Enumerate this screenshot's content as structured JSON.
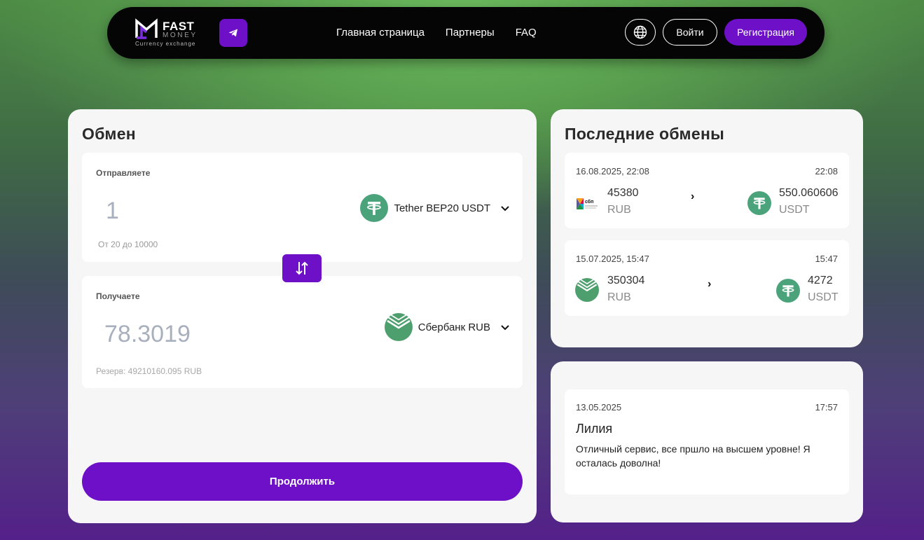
{
  "header": {
    "logo": {
      "word1": "FAST",
      "word2": "MONEY",
      "tagline": "Currency exchange"
    },
    "nav": [
      {
        "label": "Главная страница"
      },
      {
        "label": "Партнеры"
      },
      {
        "label": "FAQ"
      }
    ],
    "login_label": "Войти",
    "register_label": "Регистрация",
    "accent": "#6d10c8"
  },
  "exchange": {
    "title": "Обмен",
    "send": {
      "label": "Отправляете",
      "amount": "1",
      "currency": "Tether BEP20 USDT",
      "hint": "От 20 до 10000"
    },
    "receive": {
      "label": "Получаете",
      "amount": "78.3019",
      "currency": "Сбербанк RUB",
      "reserve_label": "Резерв:",
      "reserve_value": "49210160.095 RUB"
    },
    "continue_label": "Продолжить"
  },
  "recent": {
    "title": "Последние обмены",
    "trades": [
      {
        "date": "16.08.2025, 22:08",
        "time": "22:08",
        "from_icon": "sbp-icon",
        "from_amount": "45380",
        "from_currency": "RUB",
        "to_icon": "tether-icon",
        "to_amount": "550.060606",
        "to_currency": "USDT"
      },
      {
        "date": "15.07.2025, 15:47",
        "time": "15:47",
        "from_icon": "sberbank-icon",
        "from_amount": "350304",
        "from_currency": "RUB",
        "to_icon": "tether-icon",
        "to_amount": "4272",
        "to_currency": "USDT"
      }
    ]
  },
  "review": {
    "date": "13.05.2025",
    "time": "17:57",
    "name": "Лилия",
    "text": "Отличный сервис, все пршло на высшем уровне! Я осталась доволна!"
  }
}
